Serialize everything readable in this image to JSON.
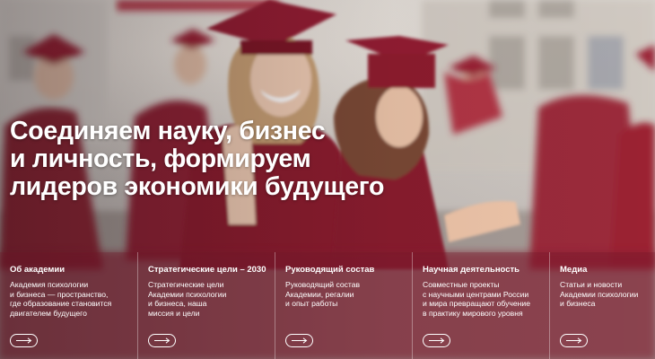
{
  "hero": {
    "headline_lines": [
      "Соединяем науку, бизнес",
      "и личность, формируем",
      "лидеров экономики будущего"
    ]
  },
  "cards": [
    {
      "title": "Об академии",
      "text": "Академия психологии\nи бизнеса — пространство,\nгде образование становится\nдвигателем будущего",
      "icon": "arrow-right-icon"
    },
    {
      "title": "Стратегические цели – 2030",
      "text": "Стратегические цели\nАкадемии психологии\nи бизнеса, наша\nмиссия и цели",
      "icon": "arrow-right-icon"
    },
    {
      "title": "Руководящий состав",
      "text": "Руководящий состав\nАкадемии, регалии\nи опыт работы",
      "icon": "arrow-right-icon"
    },
    {
      "title": "Научная деятельность",
      "text": "Совместные проекты\nс научными центрами России\nи мира превращают обучение\nв практику мирового уровня",
      "icon": "arrow-right-icon"
    },
    {
      "title": "Медиа",
      "text": "Статьи и новости\nАкадемии психологии\nи бизнеса",
      "icon": "arrow-right-icon"
    }
  ],
  "colors": {
    "gown": "#8e1f32",
    "overlay": "#6e1428",
    "text": "#ffffff"
  }
}
